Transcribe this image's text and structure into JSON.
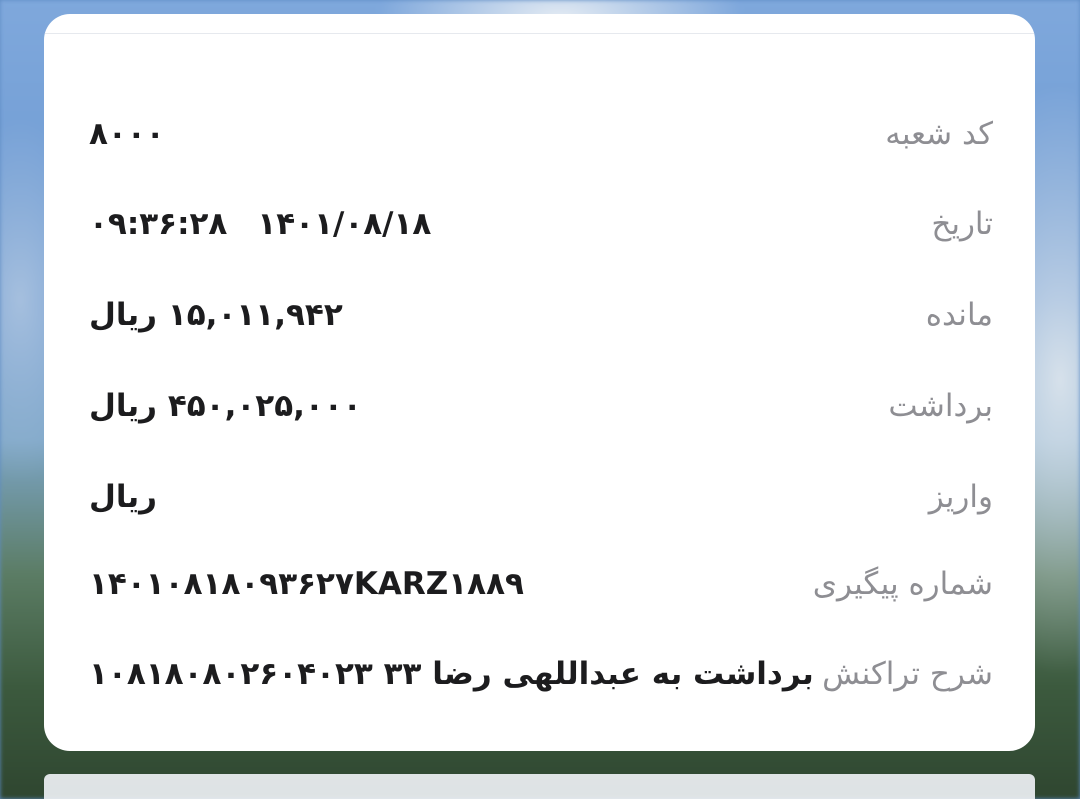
{
  "details": [
    {
      "label": "کد شعبه",
      "value": "۸۰۰۰"
    },
    {
      "label": "تاریخ",
      "date": "۱۴۰۱/۰۸/۱۸",
      "time": "۰۹:۳۶:۲۸"
    },
    {
      "label": "مانده",
      "value": "۱۵,۰۱۱,۹۴۲ ریال"
    },
    {
      "label": "برداشت",
      "value": "۴۵۰,۰۲۵,۰۰۰ ریال"
    },
    {
      "label": "واریز",
      "value": "ریال"
    },
    {
      "label": "شماره پیگیری",
      "value": "۱۴۰۱۰۸۱۸۰۹۳۶۲۷KARZ۱۸۸۹"
    },
    {
      "label": "شرح تراکنش",
      "value": "برداشت به عبداللهی رضا ۳۳ ۱۰۸۱۸۰۸۰۲۶۰۴۰۲۳"
    }
  ],
  "theme": {
    "card_background": "#ffffff",
    "label_color": "#8e8e93",
    "value_color": "#1c1c1e"
  }
}
